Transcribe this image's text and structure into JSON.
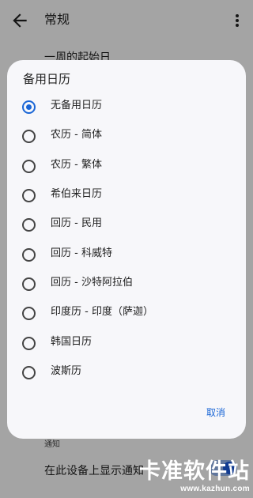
{
  "appbar": {
    "title": "常规",
    "back_icon": "arrow-back-icon",
    "more_icon": "more-vert-icon"
  },
  "background": {
    "week_start_label": "一周的起始日",
    "notifications_section": "通知",
    "show_notifications_label": "在此设备上显示通知"
  },
  "dialog": {
    "title": "备用日历",
    "options": [
      {
        "label": "无备用日历",
        "selected": true
      },
      {
        "label": "农历 - 简体",
        "selected": false
      },
      {
        "label": "农历 - 繁体",
        "selected": false
      },
      {
        "label": "希伯来日历",
        "selected": false
      },
      {
        "label": "回历 - 民用",
        "selected": false
      },
      {
        "label": "回历 - 科威特",
        "selected": false
      },
      {
        "label": "回历 - 沙特阿拉伯",
        "selected": false
      },
      {
        "label": "印度历 - 印度（萨迦）",
        "selected": false
      },
      {
        "label": "韩国日历",
        "selected": false
      },
      {
        "label": "波斯历",
        "selected": false
      }
    ],
    "cancel_label": "取消"
  },
  "watermark": {
    "logo_text": "卡准软件站",
    "url": "www.kazhun.com"
  },
  "colors": {
    "accent": "#1a66d6",
    "dialog_bg": "#f7f7fa",
    "scrim": "rgba(0,0,0,0.32)"
  }
}
